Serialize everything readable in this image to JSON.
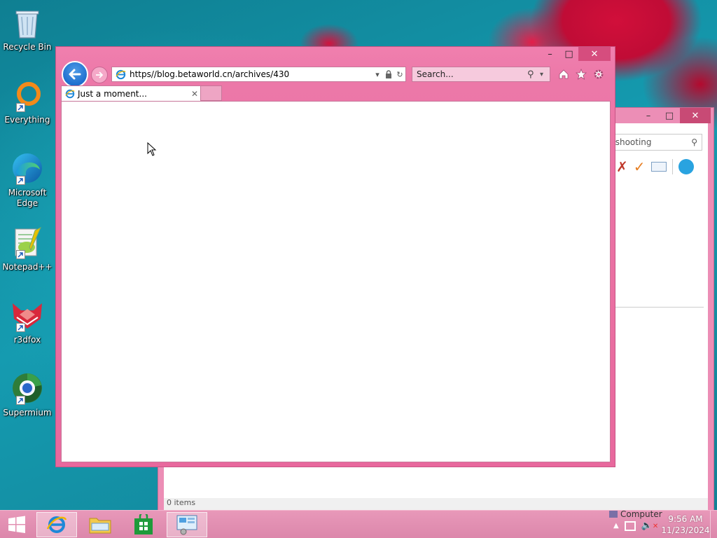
{
  "desktop": {
    "icons": [
      {
        "label": "Recycle Bin",
        "icon": "recycle-bin-icon"
      },
      {
        "label": "Everything",
        "icon": "everything-search-icon"
      },
      {
        "label": "Microsoft Edge",
        "icon": "edge-icon"
      },
      {
        "label": "Notepad++",
        "icon": "notepadpp-icon"
      },
      {
        "label": "r3dfox",
        "icon": "r3dfox-icon"
      },
      {
        "label": "Supermium",
        "icon": "supermium-icon"
      }
    ]
  },
  "background_window": {
    "search_text": "leshooting",
    "status_text": "0 items",
    "caption": {
      "minimize": "–",
      "maximize": "□",
      "close": "✕"
    }
  },
  "browser": {
    "address": "https//blog.betaworld.cn/archives/430",
    "search_placeholder": "Search...",
    "tab_title": "Just a moment...",
    "caption": {
      "minimize": "–",
      "maximize": "□",
      "close": "✕"
    },
    "accent_color": "#e8689d"
  },
  "taskbar": {
    "apps": [
      "start",
      "internet-explorer",
      "file-explorer",
      "store",
      "control-panel"
    ],
    "tray_label": "Computer",
    "time": "9:56 AM",
    "date": "11/23/2024"
  }
}
